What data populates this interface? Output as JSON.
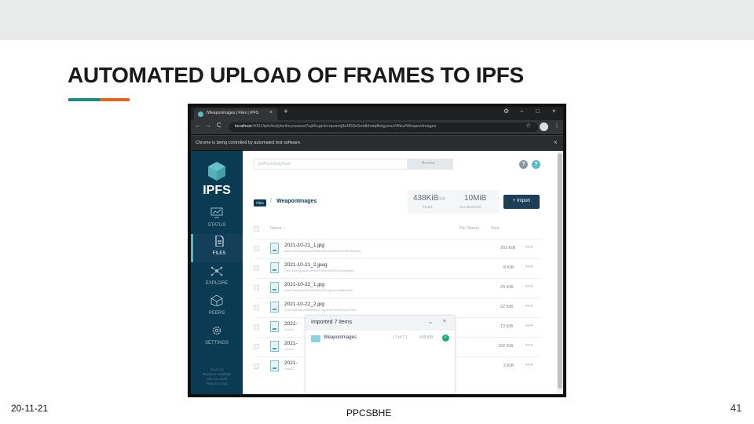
{
  "slide": {
    "title": "AUTOMATED UPLOAD OF FRAMES TO IPFS",
    "date": "20-11-21",
    "footer": "PPCSBHE",
    "page_number": "41",
    "accent_colors": [
      "#1f8a7f",
      "#e0661f"
    ]
  },
  "browser": {
    "tab_title": "/WeaponImages | Files | IPFS",
    "tab_close": "×",
    "new_tab": "+",
    "window_controls": [
      "⚙",
      "−",
      "□",
      "×"
    ],
    "nav_buttons": [
      "←",
      "→",
      "C"
    ],
    "address_host": "localhost",
    "address_rest": ":5001/ipfs/bafybeihcyruaeza7ujd6ugicbcrqumej8uf353e5etdkhotqflwtguva/#/files/WeaponImages",
    "star_icon": "☆",
    "menu_icon": "⋮",
    "infobar_text": "Chrome is being controlled by automated test software.",
    "infobar_close": "×"
  },
  "ipfs": {
    "logo": "IPFS",
    "nav": [
      {
        "label": "STATUS",
        "icon": "monitor-icon",
        "active": false
      },
      {
        "label": "FILES",
        "icon": "file-icon",
        "active": true
      },
      {
        "label": "EXPLORE",
        "icon": "network-icon",
        "active": false
      },
      {
        "label": "PEERS",
        "icon": "cube-icon",
        "active": false
      },
      {
        "label": "SETTINGS",
        "icon": "gear-icon",
        "active": false
      }
    ],
    "sidebar_footer": [
      "UI v2.13",
      "Revision 43a8b8e",
      "See the code",
      "Report a bug"
    ],
    "search_placeholder": "QmHash/bafyHash",
    "browse_label": "Browse",
    "help_icons": [
      "?",
      "?"
    ],
    "breadcrumb": {
      "root": "Files",
      "separator": "/",
      "folder": "WeaponImages"
    },
    "stats": {
      "files_size": "438KiB",
      "files_suffix": "/48",
      "files_label": "FILES",
      "blocks_size": "10MiB",
      "blocks_label": "ALL BLOCKS"
    },
    "import_label": "+ Import",
    "columns": {
      "name": "Name ↑",
      "pin": "Pin Status",
      "size": "Size"
    },
    "files": [
      {
        "name": "2021-10-21_1.jpg",
        "hash": "QmbrZ1S1VBuu2kTyR7kdMsTatTyuEkvRuXMhF2NR4BWNkfy",
        "size": "203 KiB"
      },
      {
        "name": "2021-10-21_2.jpeg",
        "hash": "QmYcL9uFQkxkHyuJ9mrKhFSwMQxDE5J3XXkwkAEgD",
        "size": "8 KiB"
      },
      {
        "name": "2021-10-22_1.jpg",
        "hash": "QmbYXpurrpKUvRKnNRmtFkXPFVgBc4oYbptBuwXdtV",
        "size": "29 KiB"
      },
      {
        "name": "2021-10-22_2.jpg",
        "hash": "QmZhhnSUv6VSoRkmHGUCT5gJkXwTmnhWj7eU3F16M",
        "size": "22 KiB"
      },
      {
        "name": "2021-",
        "hash": "QmYuV",
        "size": "72 KiB"
      },
      {
        "name": "2021-",
        "hash": "QmXhJ",
        "size": "102 KiB"
      },
      {
        "name": "2021-",
        "hash": "QmUJZ",
        "size": "2 KiB"
      }
    ],
    "more_icon": "•••",
    "popup": {
      "title": "Imported 7 items",
      "chevron": "⌄",
      "close": "×",
      "item_name": "WeaponImages",
      "item_count": "| 7 of 7 |",
      "item_size": "438 KiB",
      "ok_icon": "✓"
    }
  }
}
